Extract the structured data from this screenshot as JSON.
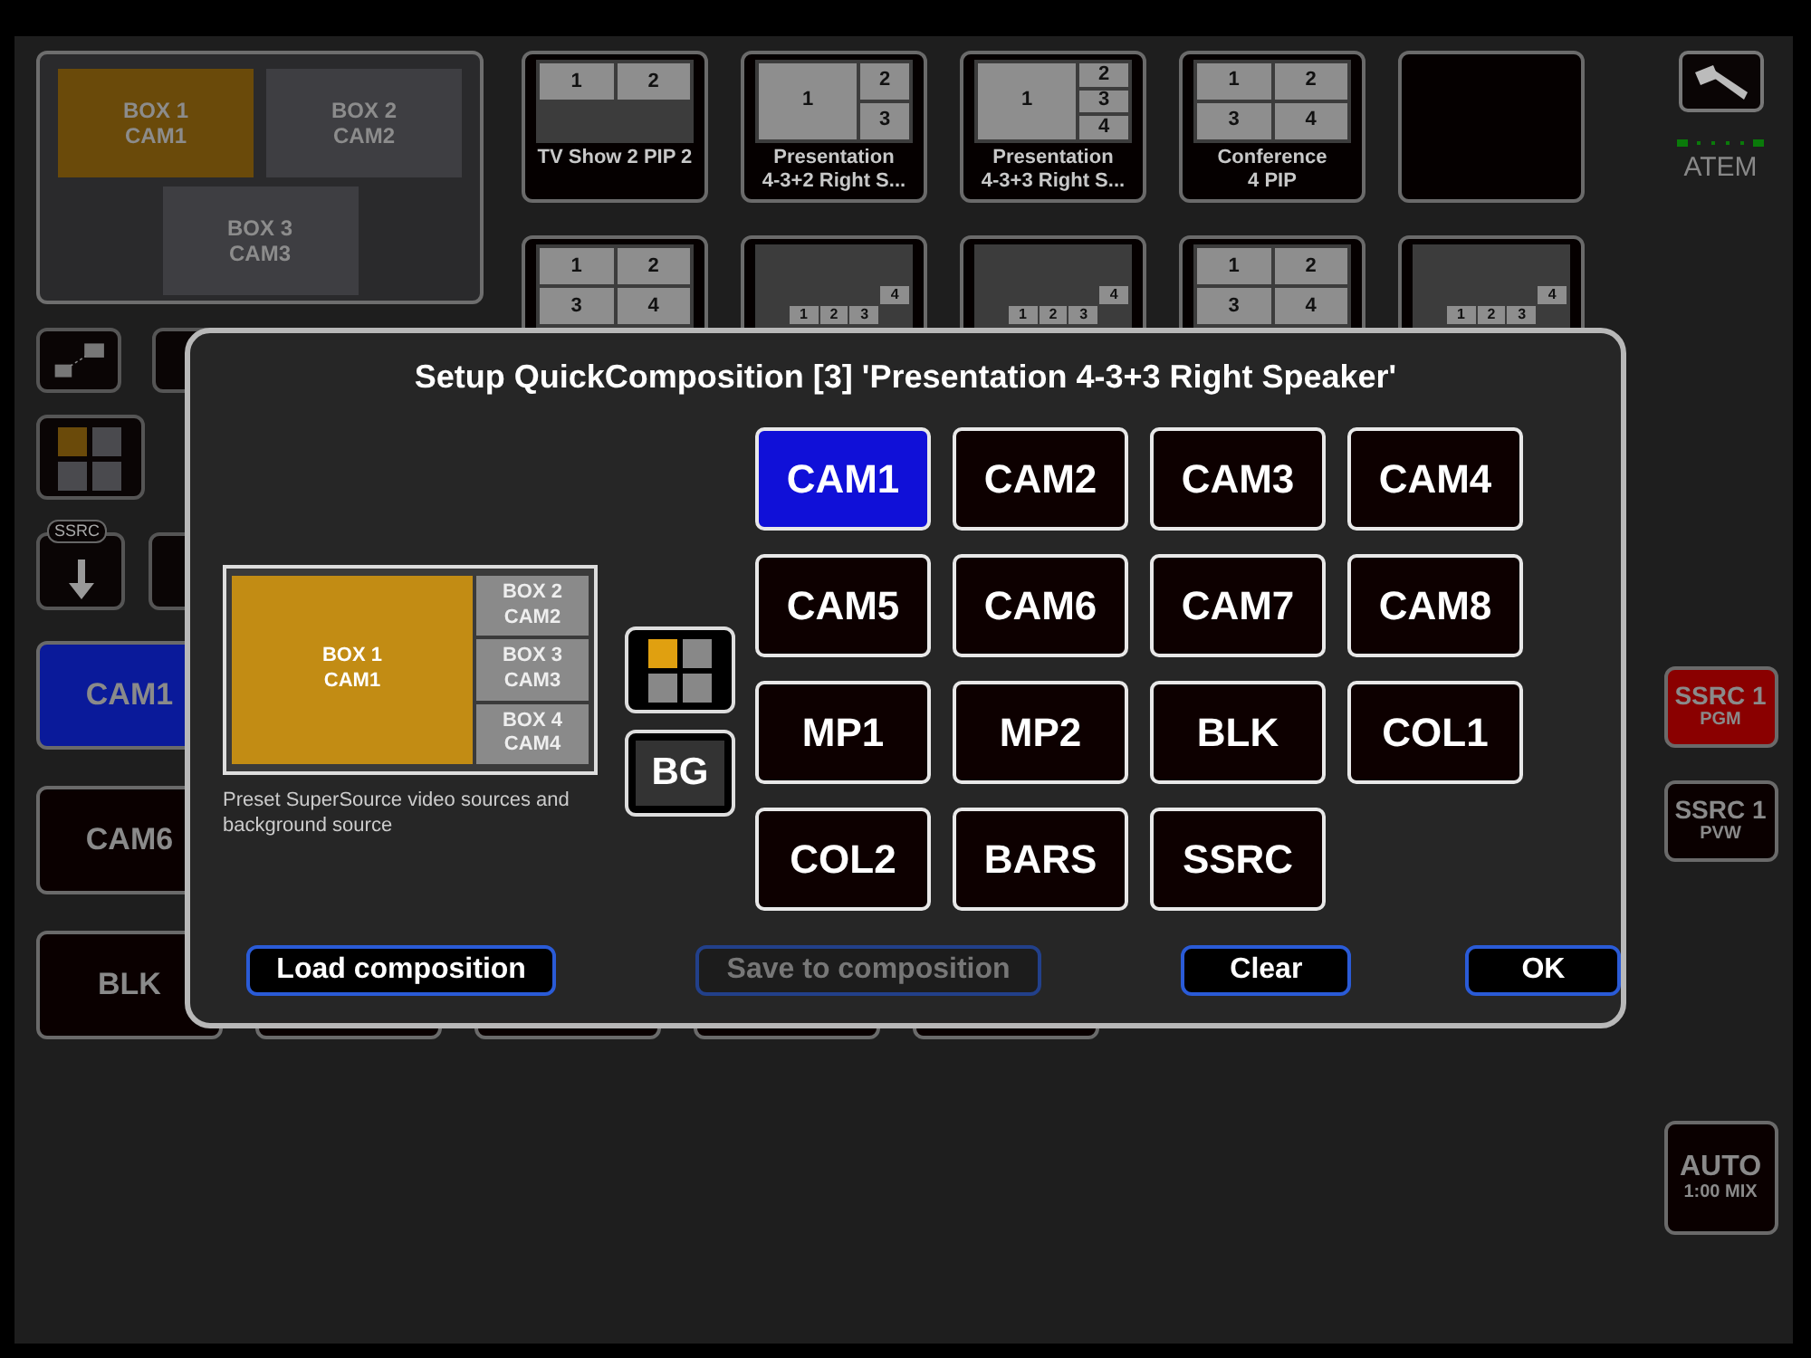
{
  "composition_panel": {
    "boxes": [
      {
        "box": "BOX 1",
        "source": "CAM1",
        "selected": true
      },
      {
        "box": "BOX 2",
        "source": "CAM2",
        "selected": false
      },
      {
        "box": "BOX 3",
        "source": "CAM3",
        "selected": false
      }
    ]
  },
  "tiles": [
    {
      "kind": "side-by-side",
      "cells": [
        "1",
        "2"
      ],
      "label_lines": [
        "TV Show 2 PIP 2"
      ]
    },
    {
      "kind": "big-right2",
      "cells": [
        "1",
        "2",
        "3"
      ],
      "label_lines": [
        "Presentation",
        "4-3+2 Right S..."
      ]
    },
    {
      "kind": "big-right3",
      "cells": [
        "1",
        "2",
        "3",
        "4"
      ],
      "label_lines": [
        "Presentation",
        "4-3+3 Right S..."
      ]
    },
    {
      "kind": "quad",
      "cells": [
        "1",
        "2",
        "3",
        "4"
      ],
      "label_lines": [
        "Conference",
        "4 PIP"
      ]
    },
    {
      "kind": "empty"
    },
    {
      "kind": "quad",
      "cells": [
        "1",
        "2",
        "3",
        "4"
      ]
    },
    {
      "kind": "corner-stack",
      "cells": [
        "1",
        "2",
        "3",
        "4"
      ]
    },
    {
      "kind": "corner-stack",
      "cells": [
        "1",
        "2",
        "3",
        "4"
      ]
    },
    {
      "kind": "quad",
      "cells": [
        "1",
        "2",
        "3",
        "4"
      ]
    },
    {
      "kind": "corner-stack",
      "cells": [
        "1",
        "2",
        "3",
        "4"
      ]
    }
  ],
  "ssrc_tab": "SSRC",
  "sources": [
    {
      "label": "CAM1",
      "selected": true
    },
    {
      "label": "CAM6",
      "selected": false
    },
    {
      "label": "BLK",
      "selected": false
    }
  ],
  "right_panel": {
    "device": "ATEM",
    "buses": [
      {
        "title": "SSRC 1",
        "sub": "PGM",
        "kind": "program"
      },
      {
        "title": "SSRC 1",
        "sub": "PVW",
        "kind": "preview"
      }
    ],
    "transition": {
      "title": "AUTO",
      "sub": "1:00 MIX"
    }
  },
  "dialog": {
    "title": "Setup QuickComposition [3] 'Presentation 4-3+3 Right Speaker'",
    "preview_boxes": [
      {
        "box": "BOX 1",
        "source": "CAM1",
        "selected": true
      },
      {
        "box": "BOX 2",
        "source": "CAM2",
        "selected": false
      },
      {
        "box": "BOX 3",
        "source": "CAM3",
        "selected": false
      },
      {
        "box": "BOX 4",
        "source": "CAM4",
        "selected": false
      }
    ],
    "caption": "Preset SuperSource video sources and background source",
    "bg_button": "BG",
    "sources": [
      {
        "label": "CAM1",
        "selected": true
      },
      {
        "label": "CAM2",
        "selected": false
      },
      {
        "label": "CAM3",
        "selected": false
      },
      {
        "label": "CAM4",
        "selected": false
      },
      {
        "label": "CAM5",
        "selected": false
      },
      {
        "label": "CAM6",
        "selected": false
      },
      {
        "label": "CAM7",
        "selected": false
      },
      {
        "label": "CAM8",
        "selected": false
      },
      {
        "label": "MP1",
        "selected": false
      },
      {
        "label": "MP2",
        "selected": false
      },
      {
        "label": "BLK",
        "selected": false
      },
      {
        "label": "COL1",
        "selected": false
      },
      {
        "label": "COL2",
        "selected": false
      },
      {
        "label": "BARS",
        "selected": false
      },
      {
        "label": "SSRC",
        "selected": false
      }
    ],
    "buttons": [
      {
        "label": "Load composition",
        "disabled": false
      },
      {
        "label": "Save to composition",
        "disabled": true
      },
      {
        "label": "Clear",
        "disabled": false
      },
      {
        "label": "OK",
        "disabled": false
      }
    ]
  }
}
